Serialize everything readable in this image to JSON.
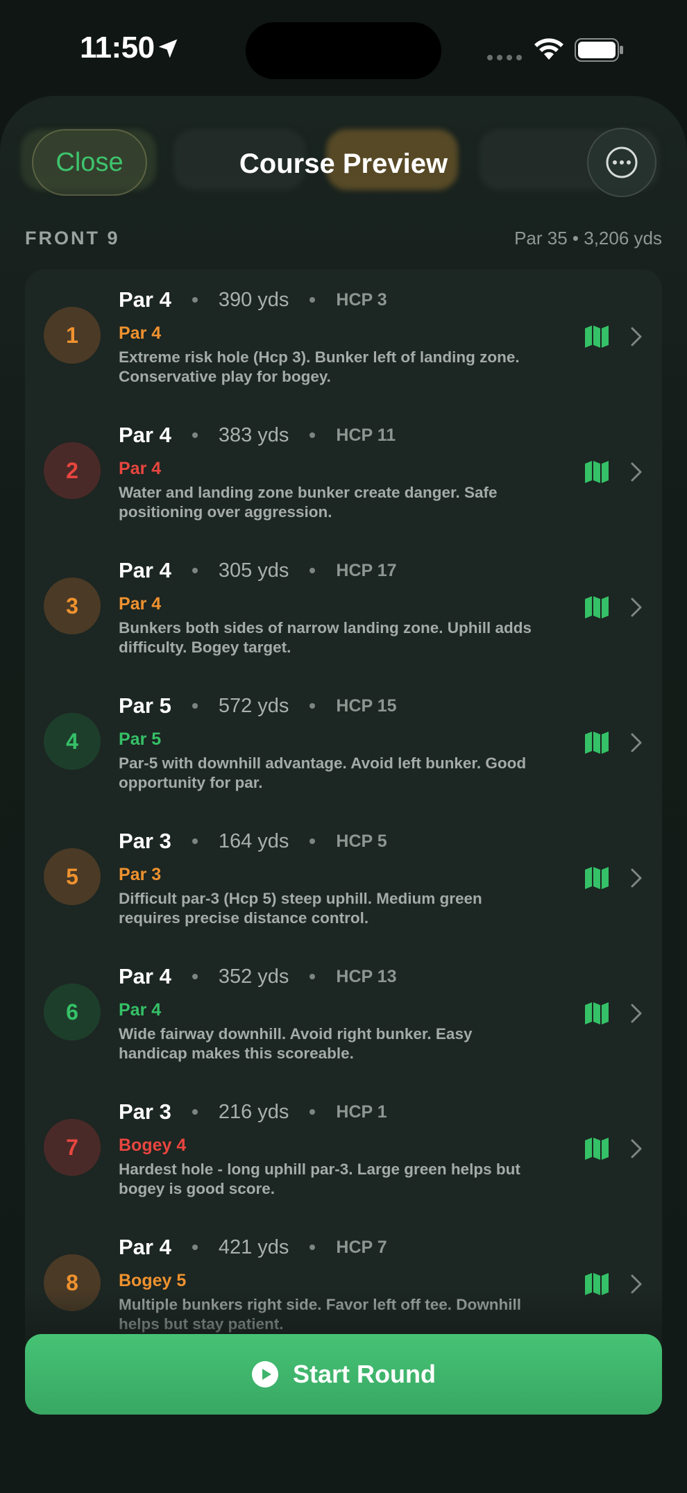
{
  "status": {
    "time": "11:50"
  },
  "nav": {
    "title": "Course Preview",
    "close_label": "Close"
  },
  "section": {
    "title": "FRONT 9",
    "meta": "Par 35 • 3,206 yds"
  },
  "holes": [
    {
      "number": "1",
      "par": "Par 4",
      "yards": "390 yds",
      "hcp": "HCP 3",
      "score": "Par 4",
      "tone": "orange",
      "desc": "Extreme risk hole (Hcp 3). Bunker left of landing zone. Conservative play for bogey."
    },
    {
      "number": "2",
      "par": "Par 4",
      "yards": "383 yds",
      "hcp": "HCP 11",
      "score": "Par 4",
      "tone": "red",
      "desc": "Water and landing zone bunker create danger. Safe positioning over aggression."
    },
    {
      "number": "3",
      "par": "Par 4",
      "yards": "305 yds",
      "hcp": "HCP 17",
      "score": "Par 4",
      "tone": "orange",
      "desc": "Bunkers both sides of narrow landing zone. Uphill adds difficulty. Bogey target."
    },
    {
      "number": "4",
      "par": "Par 5",
      "yards": "572 yds",
      "hcp": "HCP 15",
      "score": "Par 5",
      "tone": "green",
      "desc": "Par-5 with downhill advantage. Avoid left bunker. Good opportunity for par."
    },
    {
      "number": "5",
      "par": "Par 3",
      "yards": "164 yds",
      "hcp": "HCP 5",
      "score": "Par 3",
      "tone": "orange",
      "desc": "Difficult par-3 (Hcp 5) steep uphill. Medium green requires precise distance control."
    },
    {
      "number": "6",
      "par": "Par 4",
      "yards": "352 yds",
      "hcp": "HCP 13",
      "score": "Par 4",
      "tone": "green",
      "desc": "Wide fairway downhill. Avoid right bunker. Easy handicap makes this scoreable."
    },
    {
      "number": "7",
      "par": "Par 3",
      "yards": "216 yds",
      "hcp": "HCP 1",
      "score": "Bogey 4",
      "tone": "red",
      "desc": "Hardest hole - long uphill par-3. Large green helps but bogey is good score."
    },
    {
      "number": "8",
      "par": "Par 4",
      "yards": "421 yds",
      "hcp": "HCP 7",
      "score": "Bogey 5",
      "tone": "orange",
      "desc": "Multiple bunkers right side. Favor left off tee. Downhill helps but stay patient."
    }
  ],
  "actions": {
    "start_label": "Start Round"
  },
  "colors": {
    "accent": "#3ec46d",
    "orange": "#f0922f",
    "red": "#e8463f",
    "green": "#35c167"
  }
}
